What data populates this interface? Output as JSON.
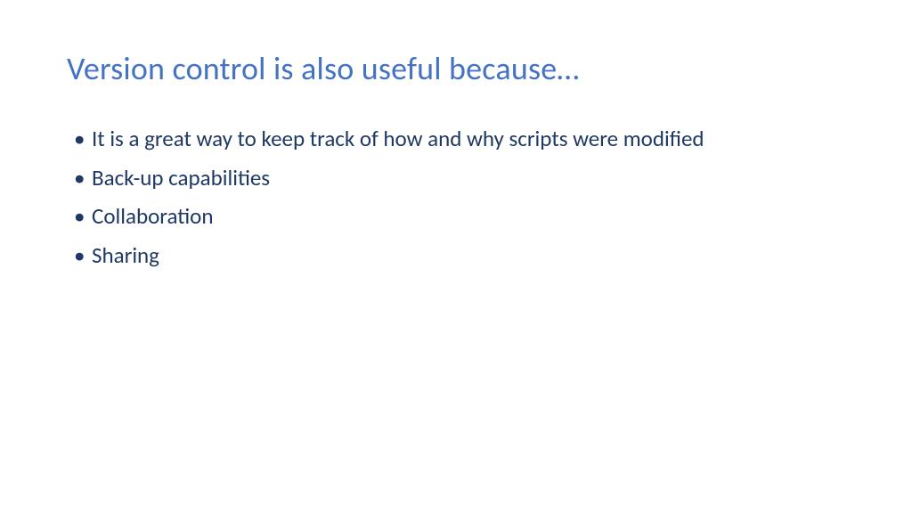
{
  "slide": {
    "title": "Version control is also useful because…",
    "bullets": [
      "It is a great way to keep track of how and why scripts were modified",
      "Back-up capabilities",
      "Collaboration",
      "Sharing"
    ]
  }
}
